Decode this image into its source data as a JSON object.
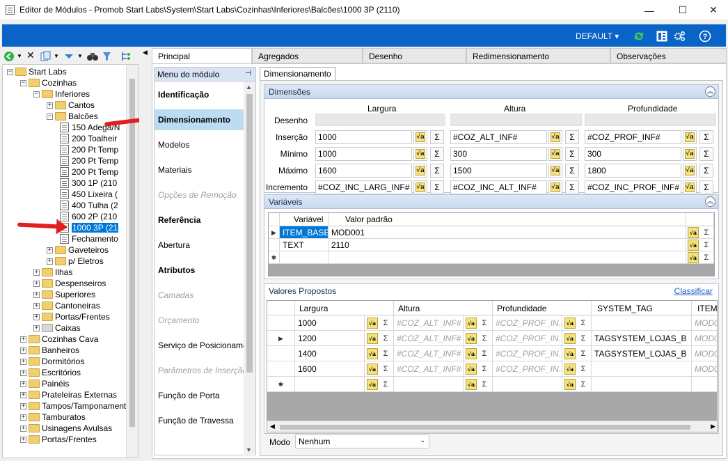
{
  "window": {
    "title": "Editor de Módulos - Promob Start Labs\\System\\Start Labs\\Cozinhas\\Inferiores\\Balcões\\1000 3P (2110)",
    "minimize": "—",
    "maximize": "☐",
    "close": "✕"
  },
  "topbar": {
    "layout_label": "DEFAULT ▾",
    "icons": [
      "refresh-icon",
      "layout-panel-icon",
      "settings-icon",
      "help-icon"
    ]
  },
  "tree": {
    "items": [
      {
        "label": "Start Labs",
        "depth": 0,
        "exp": "−",
        "type": "folder"
      },
      {
        "label": "Cozinhas",
        "depth": 1,
        "exp": "−",
        "type": "folder"
      },
      {
        "label": "Inferiores",
        "depth": 2,
        "exp": "−",
        "type": "folder"
      },
      {
        "label": "Cantos",
        "depth": 3,
        "exp": "+",
        "type": "folder"
      },
      {
        "label": "Balcões",
        "depth": 3,
        "exp": "−",
        "type": "folder"
      },
      {
        "label": "150 Adega/N",
        "depth": 4,
        "exp": "",
        "type": "doc"
      },
      {
        "label": "200 Toalheir",
        "depth": 4,
        "exp": "",
        "type": "doc"
      },
      {
        "label": "200 Pt Temp",
        "depth": 4,
        "exp": "",
        "type": "doc"
      },
      {
        "label": "200 Pt Temp",
        "depth": 4,
        "exp": "",
        "type": "doc"
      },
      {
        "label": "200 Pt Temp",
        "depth": 4,
        "exp": "",
        "type": "doc"
      },
      {
        "label": "300 1P (210",
        "depth": 4,
        "exp": "",
        "type": "doc"
      },
      {
        "label": "450 Lixeira (",
        "depth": 4,
        "exp": "",
        "type": "doc"
      },
      {
        "label": "400 Tulha (2",
        "depth": 4,
        "exp": "",
        "type": "doc"
      },
      {
        "label": "600 2P (210",
        "depth": 4,
        "exp": "",
        "type": "doc"
      },
      {
        "label": "1000 3P (21",
        "depth": 4,
        "exp": "",
        "type": "doc",
        "selected": true
      },
      {
        "label": "Fechamento",
        "depth": 4,
        "exp": "",
        "type": "doc"
      },
      {
        "label": "Gaveteiros",
        "depth": 3,
        "exp": "+",
        "type": "folder"
      },
      {
        "label": "p/ Eletros",
        "depth": 3,
        "exp": "+",
        "type": "folder"
      },
      {
        "label": "Ilhas",
        "depth": 2,
        "exp": "+",
        "type": "folder"
      },
      {
        "label": "Despenseiros",
        "depth": 2,
        "exp": "+",
        "type": "folder"
      },
      {
        "label": "Superiores",
        "depth": 2,
        "exp": "+",
        "type": "folder"
      },
      {
        "label": "Cantoneiras",
        "depth": 2,
        "exp": "+",
        "type": "folder"
      },
      {
        "label": "Portas/Frentes",
        "depth": 2,
        "exp": "+",
        "type": "folder"
      },
      {
        "label": "Caixas",
        "depth": 2,
        "exp": "+",
        "type": "folder-gray"
      },
      {
        "label": "Cozinhas Cava",
        "depth": 1,
        "exp": "+",
        "type": "folder"
      },
      {
        "label": "Banheiros",
        "depth": 1,
        "exp": "+",
        "type": "folder"
      },
      {
        "label": "Dormitórios",
        "depth": 1,
        "exp": "+",
        "type": "folder"
      },
      {
        "label": "Escritórios",
        "depth": 1,
        "exp": "+",
        "type": "folder"
      },
      {
        "label": "Painéis",
        "depth": 1,
        "exp": "+",
        "type": "folder"
      },
      {
        "label": "Prateleiras Externas",
        "depth": 1,
        "exp": "+",
        "type": "folder"
      },
      {
        "label": "Tampos/Tamponamento",
        "depth": 1,
        "exp": "+",
        "type": "folder"
      },
      {
        "label": "Tamburatos",
        "depth": 1,
        "exp": "+",
        "type": "folder"
      },
      {
        "label": "Usinagens Avulsas",
        "depth": 1,
        "exp": "+",
        "type": "folder"
      },
      {
        "label": "Portas/Frentes",
        "depth": 1,
        "exp": "+",
        "type": "folder"
      }
    ]
  },
  "tabs": [
    "Principal",
    "Agregados",
    "Desenho",
    "Redimensionamento",
    "Observações"
  ],
  "module_menu": {
    "header": "Menu do módulo",
    "items": [
      {
        "label": "Identificação",
        "style": "bold"
      },
      {
        "label": "Dimensionamento",
        "style": "bold",
        "selected": true
      },
      {
        "label": "Modelos",
        "style": "normal"
      },
      {
        "label": "Materiais",
        "style": "normal"
      },
      {
        "label": "Opções de Remoção",
        "style": "disabled"
      },
      {
        "label": "Referência",
        "style": "bold"
      },
      {
        "label": "Abertura",
        "style": "normal"
      },
      {
        "label": "Atributos",
        "style": "bold"
      },
      {
        "label": "Camadas",
        "style": "disabled"
      },
      {
        "label": "Orçamento",
        "style": "disabled"
      },
      {
        "label": "Serviço de Posicionamento",
        "style": "normal"
      },
      {
        "label": "Parâmetros de Inserção",
        "style": "disabled"
      },
      {
        "label": "Função de Porta",
        "style": "normal"
      },
      {
        "label": "Função de Travessa",
        "style": "normal"
      }
    ]
  },
  "inner_tab": "Dimensionamento",
  "dimensoes": {
    "title": "Dimensões",
    "columns": [
      "Largura",
      "Altura",
      "Profundidade"
    ],
    "rows": [
      {
        "label": "Desenho",
        "values": [
          "",
          "",
          ""
        ],
        "disabled": true
      },
      {
        "label": "Inserção",
        "values": [
          "1000",
          "#COZ_ALT_INF#",
          "#COZ_PROF_INF#"
        ]
      },
      {
        "label": "Mínimo",
        "values": [
          "1000",
          "300",
          "300"
        ]
      },
      {
        "label": "Máximo",
        "values": [
          "1600",
          "1500",
          "1800"
        ]
      },
      {
        "label": "Incremento",
        "values": [
          "#COZ_INC_LARG_INF#",
          "#COZ_INC_ALT_INF#",
          "#COZ_INC_PROF_INF#"
        ]
      }
    ]
  },
  "variaveis": {
    "title": "Variáveis",
    "columns": [
      "Variável",
      "Valor padrão"
    ],
    "rows": [
      {
        "name": "ITEM_BASE",
        "value": "MOD001",
        "marker": "▶"
      },
      {
        "name": "TEXT",
        "value": "2110",
        "marker": ""
      },
      {
        "name": "",
        "value": "",
        "marker": "✱"
      }
    ]
  },
  "valores": {
    "title": "Valores Propostos",
    "sort_link": "Classificar",
    "columns": [
      "Largura",
      "Altura",
      "Profundidade",
      "SYSTEM_TAG",
      "ITEM_"
    ],
    "rows": [
      {
        "marker": "",
        "largura": "1000",
        "altura": "#COZ_ALT_INF#",
        "prof": "#COZ_PROF_IN...",
        "tag": "",
        "item": "MOD0"
      },
      {
        "marker": "▶",
        "largura": "1200",
        "altura": "#COZ_ALT_INF#",
        "prof": "#COZ_PROF_IN...",
        "tag": "TAGSYSTEM_LOJAS_B",
        "item": "MOD0"
      },
      {
        "marker": "",
        "largura": "1400",
        "altura": "#COZ_ALT_INF#",
        "prof": "#COZ_PROF_IN...",
        "tag": "TAGSYSTEM_LOJAS_B",
        "item": "MOD0"
      },
      {
        "marker": "",
        "largura": "1600",
        "altura": "#COZ_ALT_INF#",
        "prof": "#COZ_PROF_IN...",
        "tag": "",
        "item": "MOD0"
      },
      {
        "marker": "✱",
        "largura": "",
        "altura": "",
        "prof": "",
        "tag": "",
        "item": ""
      }
    ]
  },
  "modo": {
    "label": "Modo",
    "value": "Nenhum"
  },
  "symbols": {
    "fx": "√a",
    "sum": "Σ",
    "pin": "📌",
    "collapse": "︽"
  },
  "colors": {
    "accent": "#0a64c8",
    "selection": "#0078d7",
    "menu_selected": "#bcdcf2",
    "arrow": "#e02020"
  }
}
